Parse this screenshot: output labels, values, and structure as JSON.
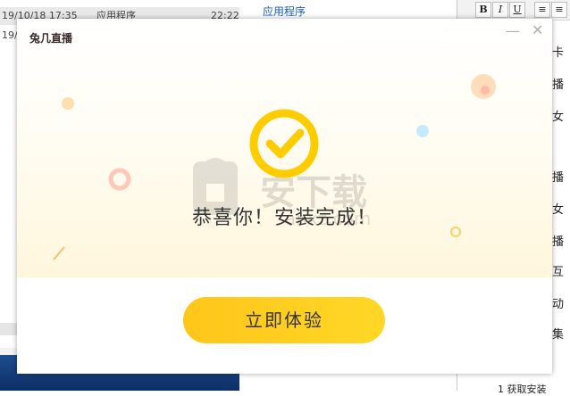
{
  "background": {
    "file_row": {
      "date": "19/10/18 17:35",
      "type": "应用程序",
      "time": "22:22"
    },
    "file_row_2_date": "19/",
    "mid_link": "应用程序",
    "editor_toolbar": {
      "bold": "B",
      "italic": "I",
      "underline": "U"
    },
    "editor_lines": [
      "卡",
      "播",
      "女",
      "播",
      "女",
      "播",
      "互",
      "动",
      "集"
    ],
    "bottom_text": "1 获取安装"
  },
  "dialog": {
    "logo": "兔几直播",
    "minimize_glyph": "—",
    "close_glyph": "✕",
    "success_text": "恭喜你！安装完成！",
    "primary_button": "立即体验",
    "check_color": "#ffcc00",
    "accent_color": "#ffd21f"
  },
  "watermark": {
    "text": "安下载",
    "sub": "anxz.com"
  }
}
